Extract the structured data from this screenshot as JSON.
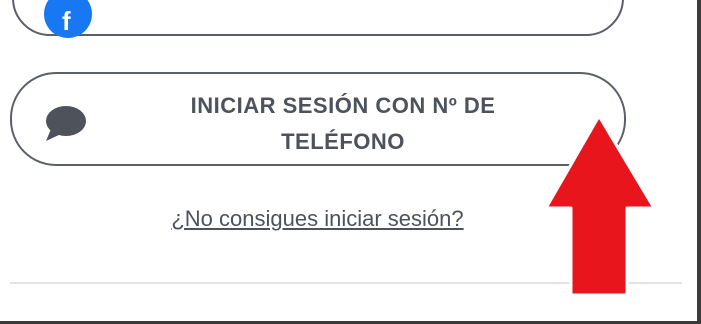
{
  "facebook_button": {
    "icon": "facebook-icon",
    "glyph": "f",
    "brand_color": "#1877f2"
  },
  "phone_login_button": {
    "label": "INICIAR SESIÓN CON Nº DE\nTELÉFONO",
    "icon": "chat-bubble-icon"
  },
  "help_link": {
    "label": "¿No consigues iniciar sesión?"
  },
  "annotation": {
    "icon": "up-arrow-icon",
    "color": "#e8151d"
  },
  "colors": {
    "border": "#5b5f68",
    "text": "#4e525b",
    "divider": "#e1e3e6"
  }
}
